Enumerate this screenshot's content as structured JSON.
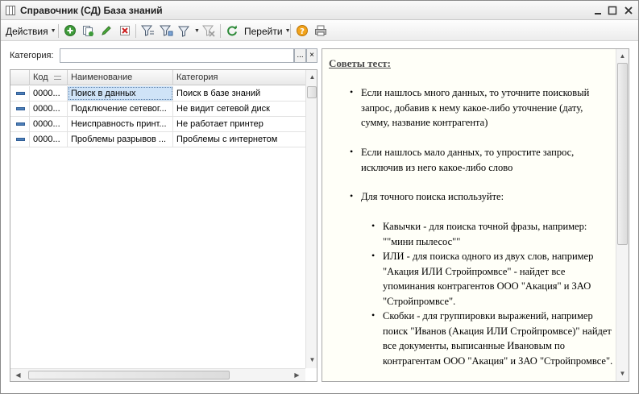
{
  "window": {
    "title": "Справочник (СД) База знаний"
  },
  "toolbar": {
    "actions_label": "Действия",
    "goto_label": "Перейти"
  },
  "filter": {
    "category_label": "Категория:",
    "category_value": "",
    "choose_label": "...",
    "clear_label": "×"
  },
  "table": {
    "columns": [
      "Код",
      "Наименование",
      "Категория"
    ],
    "rows": [
      {
        "code": "0000...",
        "name": "Поиск в данных",
        "category": "Поиск в базе знаний"
      },
      {
        "code": "0000...",
        "name": "Подключение сетевог...",
        "category": "Не видит сетевой диск"
      },
      {
        "code": "0000...",
        "name": "Неисправность принт...",
        "category": "Не работает принтер"
      },
      {
        "code": "0000...",
        "name": "Проблемы разрывов ...",
        "category": "Проблемы с интернетом"
      }
    ],
    "selected_row": 0
  },
  "tips": {
    "title": "Советы тест:",
    "items": [
      "Если нашлось много данных, то уточните поисковый запрос, добавив к нему какое-либо уточнение (дату, сумму, название контрагента)",
      "Если нашлось мало данных, то упростите запрос, исключив из него какое-либо слово",
      "Для точного поиска используйте:"
    ],
    "subitems": [
      "Кавычки - для поиска точной фразы, например: \"\"мини пылесос\"\"",
      "ИЛИ - для поиска одного из двух слов, например \"Акация ИЛИ Стройпромвсе\" - найдет все упоминания контрагентов ООО \"Акация\" и ЗАО \"Стройпромвсе\".",
      "Скобки - для группировки выражений, например поиск \"Иванов (Акация ИЛИ Стройпромвсе)\" найдет все документы, выписанные Ивановым по контрагентам ООО \"Акация\" и ЗАО \"Стройпромвсе\"."
    ]
  },
  "icons": {
    "app": "table-icon",
    "add": "add-circle-icon",
    "copy": "copy-icon",
    "edit": "pencil-icon",
    "delete": "delete-icon",
    "filter_set": "filter-set-icon",
    "filter_value": "filter-value-icon",
    "filter_list": "filter-list-icon",
    "filter_off": "filter-off-icon",
    "refresh": "refresh-icon",
    "help": "help-icon",
    "print": "print-icon"
  },
  "colors": {
    "selection": "#cfe3f7",
    "tips_background": "#fffff8",
    "add_green": "#3e9b3a",
    "delete_red": "#cc2020",
    "help_orange": "#e69500"
  }
}
